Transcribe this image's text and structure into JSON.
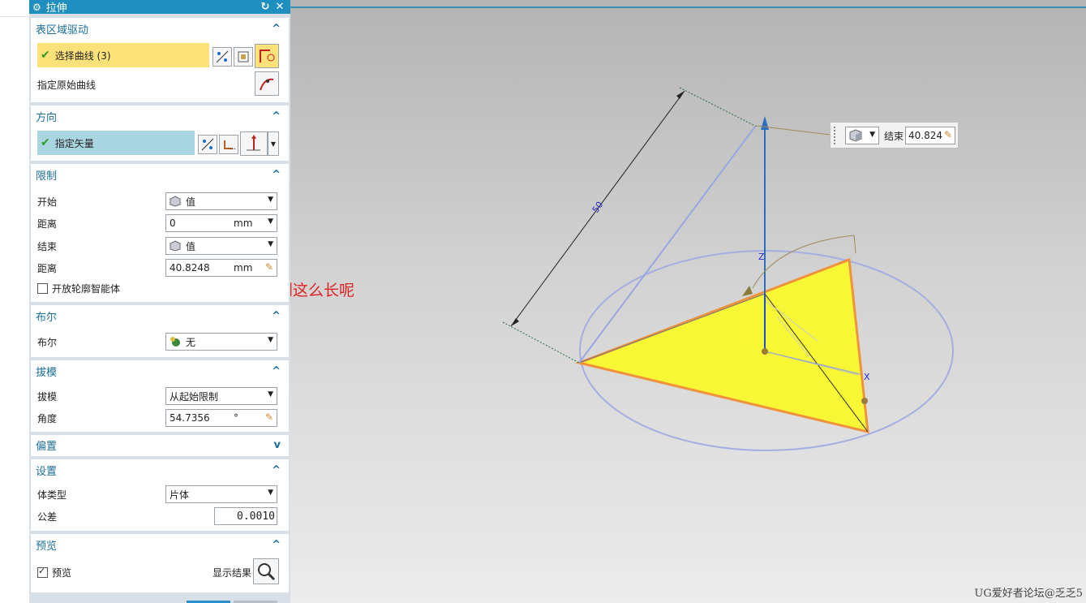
{
  "dialog": {
    "title": "拉伸",
    "sections": {
      "surface": {
        "title": "表区域驱动",
        "select_curve": "选择曲线 (3)",
        "origin_curve": "指定原始曲线"
      },
      "direction": {
        "title": "方向",
        "vector": "指定矢量"
      },
      "limits": {
        "title": "限制",
        "start_label": "开始",
        "start_value": "值",
        "start_dist_label": "距离",
        "start_dist": "0",
        "start_unit": "mm",
        "end_label": "结束",
        "end_value": "值",
        "end_dist_label": "距离",
        "end_dist": "40.8248",
        "end_unit": "mm",
        "open_profile": "开放轮廓智能体"
      },
      "boolean": {
        "title": "布尔",
        "label": "布尔",
        "value": "无"
      },
      "draft": {
        "title": "拔模",
        "label": "拔模",
        "value": "从起始限制",
        "angle_label": "角度",
        "angle": "54.7356",
        "angle_unit": "°"
      },
      "offset": {
        "title": "偏置"
      },
      "settings": {
        "title": "设置",
        "body_type_label": "体类型",
        "body_type": "片体",
        "tolerance_label": "公差",
        "tolerance": "0.0010"
      },
      "preview": {
        "title": "预览",
        "preview_label": "预览",
        "show_result": "显示结果"
      }
    }
  },
  "annotation": "为啥这个不能拉伸到这么长呢",
  "viewport": {
    "dimension_label": "50",
    "axis_z": "Z",
    "axis_x": "X",
    "end_box": {
      "label": "结束",
      "value": "40.824"
    }
  },
  "watermark": "UG爱好者论坛@乏乏5",
  "colors": {
    "accent": "#1f8fc0",
    "selected_bar": "#fde27a",
    "vector_bar": "#a9d5e0",
    "triangle": "#f7f735",
    "edge": "#f0923c"
  }
}
